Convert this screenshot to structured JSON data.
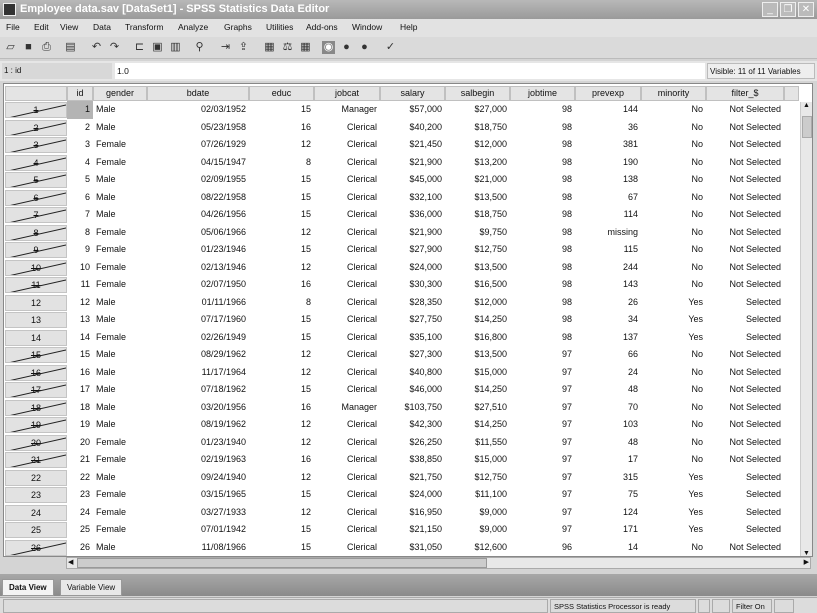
{
  "window": {
    "title": "Employee data.sav [DataSet1] - SPSS Statistics Data Editor",
    "minimize": "_",
    "maximize": "❐",
    "close": "✕"
  },
  "menu": [
    "File",
    "Edit",
    "View",
    "Data",
    "Transform",
    "Analyze",
    "Graphs",
    "Utilities",
    "Add-ons",
    "Window",
    "Help"
  ],
  "toolbar": [
    "open-icon",
    "save-icon",
    "print-icon",
    "dialog-recall-icon",
    "undo-icon",
    "redo-icon",
    "goto-case-icon",
    "goto-variable-icon",
    "variables-icon",
    "find-icon",
    "insert-cases-icon",
    "insert-variable-icon",
    "split-file-icon",
    "weight-cases-icon",
    "select-cases-icon",
    "value-labels-icon",
    "use-sets-icon",
    "show-all-icon",
    "spell-check-icon"
  ],
  "cell_editor": {
    "ref": "1 : id",
    "value": "1.0",
    "visible": "Visible: 11 of 11 Variables"
  },
  "columns": [
    "id",
    "gender",
    "bdate",
    "educ",
    "jobcat",
    "salary",
    "salbegin",
    "jobtime",
    "prevexp",
    "minority",
    "filter_$"
  ],
  "rows": [
    [
      "1",
      "Male",
      "02/03/1952",
      "15",
      "Manager",
      "$57,000",
      "$27,000",
      "98",
      "144",
      "No",
      "Not Selected"
    ],
    [
      "2",
      "Male",
      "05/23/1958",
      "16",
      "Clerical",
      "$40,200",
      "$18,750",
      "98",
      "36",
      "No",
      "Not Selected"
    ],
    [
      "3",
      "Female",
      "07/26/1929",
      "12",
      "Clerical",
      "$21,450",
      "$12,000",
      "98",
      "381",
      "No",
      "Not Selected"
    ],
    [
      "4",
      "Female",
      "04/15/1947",
      "8",
      "Clerical",
      "$21,900",
      "$13,200",
      "98",
      "190",
      "No",
      "Not Selected"
    ],
    [
      "5",
      "Male",
      "02/09/1955",
      "15",
      "Clerical",
      "$45,000",
      "$21,000",
      "98",
      "138",
      "No",
      "Not Selected"
    ],
    [
      "6",
      "Male",
      "08/22/1958",
      "15",
      "Clerical",
      "$32,100",
      "$13,500",
      "98",
      "67",
      "No",
      "Not Selected"
    ],
    [
      "7",
      "Male",
      "04/26/1956",
      "15",
      "Clerical",
      "$36,000",
      "$18,750",
      "98",
      "114",
      "No",
      "Not Selected"
    ],
    [
      "8",
      "Female",
      "05/06/1966",
      "12",
      "Clerical",
      "$21,900",
      "$9,750",
      "98",
      "missing",
      "No",
      "Not Selected"
    ],
    [
      "9",
      "Female",
      "01/23/1946",
      "15",
      "Clerical",
      "$27,900",
      "$12,750",
      "98",
      "115",
      "No",
      "Not Selected"
    ],
    [
      "10",
      "Female",
      "02/13/1946",
      "12",
      "Clerical",
      "$24,000",
      "$13,500",
      "98",
      "244",
      "No",
      "Not Selected"
    ],
    [
      "11",
      "Female",
      "02/07/1950",
      "16",
      "Clerical",
      "$30,300",
      "$16,500",
      "98",
      "143",
      "No",
      "Not Selected"
    ],
    [
      "12",
      "Male",
      "01/11/1966",
      "8",
      "Clerical",
      "$28,350",
      "$12,000",
      "98",
      "26",
      "Yes",
      "Selected"
    ],
    [
      "13",
      "Male",
      "07/17/1960",
      "15",
      "Clerical",
      "$27,750",
      "$14,250",
      "98",
      "34",
      "Yes",
      "Selected"
    ],
    [
      "14",
      "Female",
      "02/26/1949",
      "15",
      "Clerical",
      "$35,100",
      "$16,800",
      "98",
      "137",
      "Yes",
      "Selected"
    ],
    [
      "15",
      "Male",
      "08/29/1962",
      "12",
      "Clerical",
      "$27,300",
      "$13,500",
      "97",
      "66",
      "No",
      "Not Selected"
    ],
    [
      "16",
      "Male",
      "11/17/1964",
      "12",
      "Clerical",
      "$40,800",
      "$15,000",
      "97",
      "24",
      "No",
      "Not Selected"
    ],
    [
      "17",
      "Male",
      "07/18/1962",
      "15",
      "Clerical",
      "$46,000",
      "$14,250",
      "97",
      "48",
      "No",
      "Not Selected"
    ],
    [
      "18",
      "Male",
      "03/20/1956",
      "16",
      "Manager",
      "$103,750",
      "$27,510",
      "97",
      "70",
      "No",
      "Not Selected"
    ],
    [
      "19",
      "Male",
      "08/19/1962",
      "12",
      "Clerical",
      "$42,300",
      "$14,250",
      "97",
      "103",
      "No",
      "Not Selected"
    ],
    [
      "20",
      "Female",
      "01/23/1940",
      "12",
      "Clerical",
      "$26,250",
      "$11,550",
      "97",
      "48",
      "No",
      "Not Selected"
    ],
    [
      "21",
      "Female",
      "02/19/1963",
      "16",
      "Clerical",
      "$38,850",
      "$15,000",
      "97",
      "17",
      "No",
      "Not Selected"
    ],
    [
      "22",
      "Male",
      "09/24/1940",
      "12",
      "Clerical",
      "$21,750",
      "$12,750",
      "97",
      "315",
      "Yes",
      "Selected"
    ],
    [
      "23",
      "Female",
      "03/15/1965",
      "15",
      "Clerical",
      "$24,000",
      "$11,100",
      "97",
      "75",
      "Yes",
      "Selected"
    ],
    [
      "24",
      "Female",
      "03/27/1933",
      "12",
      "Clerical",
      "$16,950",
      "$9,000",
      "97",
      "124",
      "Yes",
      "Selected"
    ],
    [
      "25",
      "Female",
      "07/01/1942",
      "15",
      "Clerical",
      "$21,150",
      "$9,000",
      "97",
      "171",
      "Yes",
      "Selected"
    ],
    [
      "26",
      "Male",
      "11/08/1966",
      "15",
      "Clerical",
      "$31,050",
      "$12,600",
      "96",
      "14",
      "No",
      "Not Selected"
    ]
  ],
  "tabs": {
    "data_view": "Data View",
    "variable_view": "Variable View"
  },
  "status": {
    "processor": "SPSS Statistics  Processor is ready",
    "filter": "Filter On"
  }
}
